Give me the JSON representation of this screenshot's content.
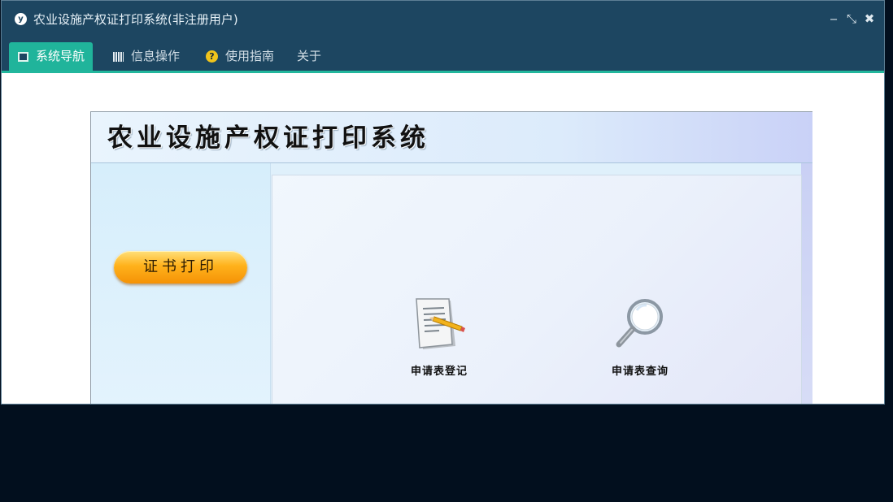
{
  "window": {
    "title": "农业设施产权证打印系统(非注册用户)",
    "app_icon_glyph": "y",
    "controls": {
      "minimize": "‒",
      "restore": "⤡",
      "close": "✖"
    }
  },
  "menu": {
    "items": [
      {
        "label": "系统导航",
        "icon": "monitor-icon",
        "active": true
      },
      {
        "label": "信息操作",
        "icon": "grid-icon",
        "active": false
      },
      {
        "label": "使用指南",
        "icon": "help-icon",
        "active": false
      },
      {
        "label": "关于",
        "icon": "",
        "active": false
      }
    ]
  },
  "panel": {
    "title": "农业设施产权证打印系统",
    "cert_print_button": "证书打印",
    "actions": [
      {
        "label": "申请表登记",
        "icon": "document-pencil-icon"
      },
      {
        "label": "申请表查询",
        "icon": "magnifier-icon"
      }
    ]
  },
  "colors": {
    "titlebar": "#1d4661",
    "accent": "#20b49b",
    "button_orange": "#ffb21c"
  }
}
